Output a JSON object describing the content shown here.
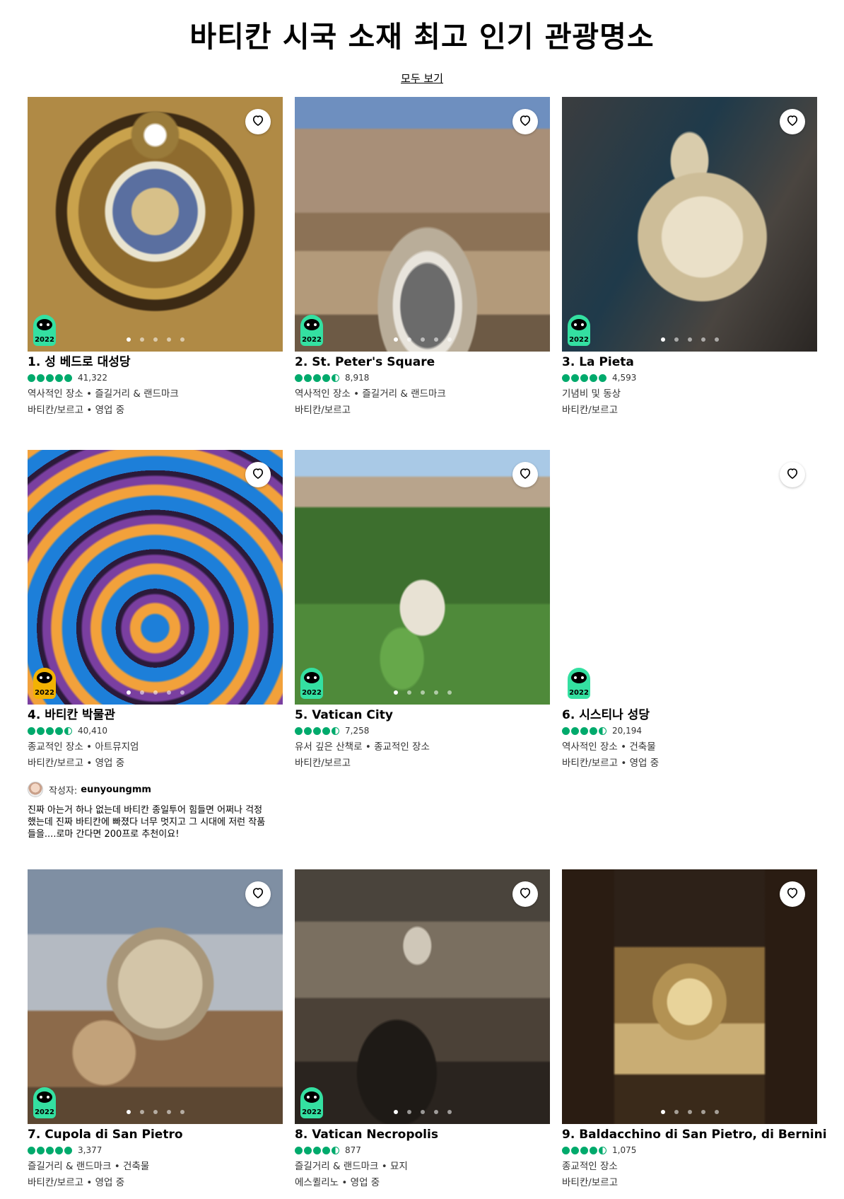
{
  "page": {
    "title": "바티칸 시국 소재 최고 인기 관광명소",
    "view_all": "모두 보기"
  },
  "icons": {
    "save": "heart-outline-icon",
    "award": "travelers-choice-badge-icon",
    "rating": "rating-bubbles-icon"
  },
  "colors": {
    "rating_green": "#00aa6c",
    "award_green": "#34e0a1",
    "award_gold": "#f2b203"
  },
  "cards": [
    {
      "name": "1. 성 베드로 대성당",
      "rating": 5,
      "reviews": "41,322",
      "category": "역사적인 장소 • 즐길거리 & 랜드마크",
      "location": "바티칸/보르고 • 영업 중",
      "award_year": "2022",
      "award_tier": "green",
      "slide_count": 5,
      "active_slide": 1
    },
    {
      "name": "2. St. Peter's Square",
      "rating": 4.5,
      "reviews": "8,918",
      "category": "역사적인 장소 • 즐길거리 & 랜드마크",
      "location": "바티칸/보르고",
      "award_year": "2022",
      "award_tier": "green",
      "slide_count": 5,
      "active_slide": 1
    },
    {
      "name": "3. La Pieta",
      "rating": 5,
      "reviews": "4,593",
      "category": "기념비 및 동상",
      "location": "바티칸/보르고",
      "award_year": "2022",
      "award_tier": "green",
      "slide_count": 5,
      "active_slide": 1
    },
    {
      "name": "4. 바티칸 박물관",
      "rating": 4.5,
      "reviews": "40,410",
      "category": "종교적인 장소 • 아트뮤지엄",
      "location": "바티칸/보르고 • 영업 중",
      "award_year": "2022",
      "award_tier": "gold",
      "slide_count": 5,
      "active_slide": 1
    },
    {
      "name": "5. Vatican City",
      "rating": 4.5,
      "reviews": "7,258",
      "category": "유서 깊은 산책로 • 종교적인 장소",
      "location": "바티칸/보르고",
      "award_year": "2022",
      "award_tier": "green",
      "slide_count": 5,
      "active_slide": 1
    },
    {
      "name": "6. 시스티나 성당",
      "rating": 4.5,
      "reviews": "20,194",
      "category": "역사적인 장소 • 건축물",
      "location": "바티칸/보르고 • 영업 중",
      "award_year": "2022",
      "award_tier": "green",
      "slide_count": 5,
      "active_slide": 1
    },
    {
      "name": "7. Cupola di San Pietro",
      "rating": 5,
      "reviews": "3,377",
      "category": "즐길거리 & 랜드마크 • 건축물",
      "location": "바티칸/보르고 • 영업 중",
      "award_year": "2022",
      "award_tier": "green",
      "slide_count": 5,
      "active_slide": 1
    },
    {
      "name": "8. Vatican Necropolis",
      "rating": 4.5,
      "reviews": "877",
      "category": "즐길거리 & 랜드마크 • 묘지",
      "location": "에스퀼리노 • 영업 중",
      "award_year": "2022",
      "award_tier": "green",
      "slide_count": 5,
      "active_slide": 1
    },
    {
      "name": "9. Baldacchino di San Pietro, di Bernini",
      "rating": 4.5,
      "reviews": "1,075",
      "category": "종교적인 장소",
      "location": "바티칸/보르고",
      "award_year": "",
      "award_tier": "",
      "slide_count": 5,
      "active_slide": 1
    }
  ],
  "review": {
    "author_prefix": "작성자:",
    "author": "eunyoungmm",
    "text": "진짜 아는거 하나 없는데 바티칸 종일투어 힘들면 어쩌나 걱정했는데 진짜 바티칸에 빠졌다 너무 멋지고 그 시대에 저런 작품들을....로마 간다면 200프로 추천이요!"
  }
}
